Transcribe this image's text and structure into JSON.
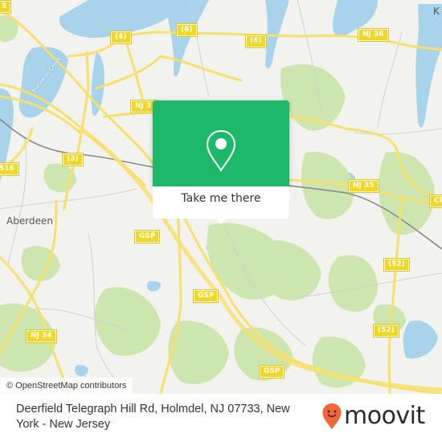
{
  "map": {
    "attribution": "© OpenStreetMap contributors",
    "place_labels": {
      "aberdeen": "Aberdeen",
      "keyport_partial": "K",
      "creek": "Matawan Creek"
    },
    "road_shields": {
      "r4": "(4)",
      "r6a": "(6)",
      "r6b": "(6)",
      "nj36": "NJ 36",
      "nj3x": "NJ 3",
      "r3": "(3)",
      "r516": "516",
      "r5": "5",
      "nj35": "NJ 35",
      "cr": "CR",
      "gsp1": "GSP",
      "gsp2": "GSP",
      "gsp3": "GSP",
      "r52a": "(52)",
      "r52b": "(52)",
      "nj34": "NJ 34"
    },
    "colors": {
      "land": "#f2f2ef",
      "water": "#a9d3ea",
      "forest": "#cde6b0",
      "road": "#f7e06b",
      "shield": "#f2d722"
    }
  },
  "popup": {
    "icon": "map-pin-icon",
    "button_label": "Take me there",
    "accent_color": "#1db86a"
  },
  "footer": {
    "address": "Deerfield Telegraph Hill Rd, Holmdel, NJ 07733, New York - New Jersey",
    "brand": "moovit",
    "brand_color": "#f26538"
  }
}
